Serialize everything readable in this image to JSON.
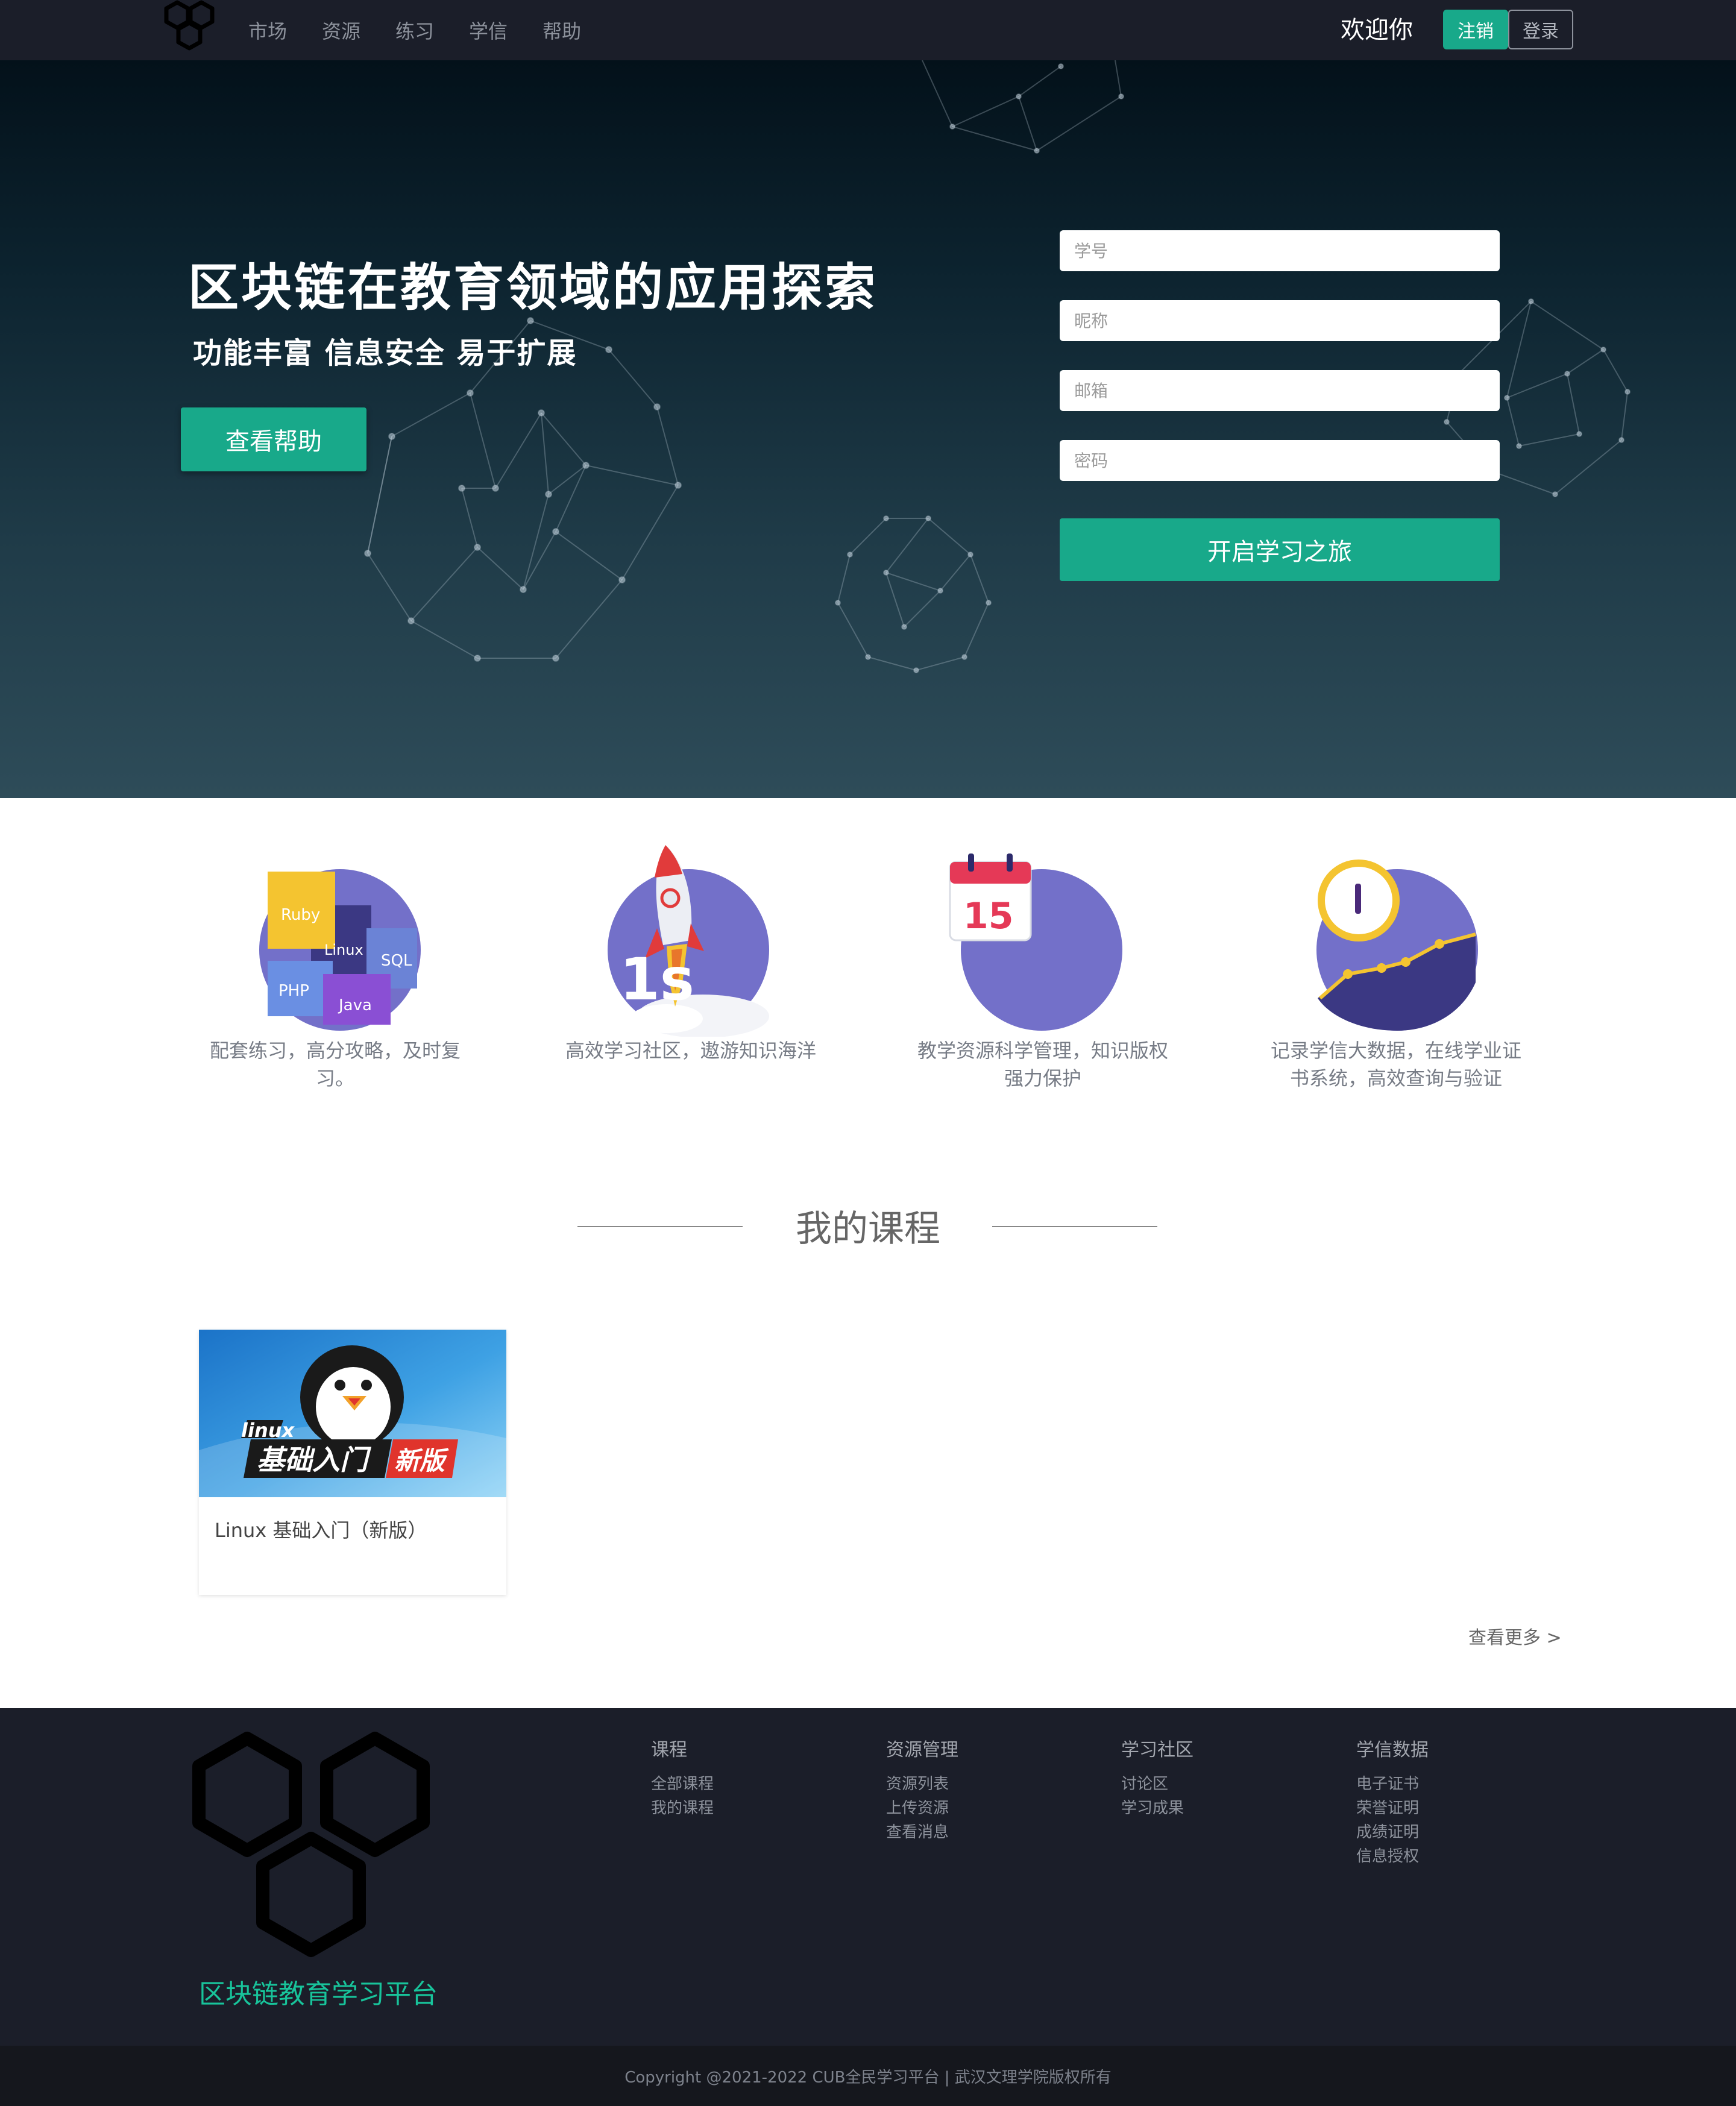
{
  "nav": {
    "links": [
      "市场",
      "资源",
      "练习",
      "学信",
      "帮助"
    ],
    "welcome": "欢迎你",
    "logout": "注销",
    "login": "登录"
  },
  "hero": {
    "title": "区块链在教育领域的应用探索",
    "subtitle": "功能丰富 信息安全 易于扩展",
    "help_button": "查看帮助"
  },
  "register": {
    "student_id_placeholder": "学号",
    "nickname_placeholder": "昵称",
    "email_placeholder": "邮箱",
    "password_placeholder": "密码",
    "submit": "开启学习之旅"
  },
  "features": [
    {
      "icon": "languages-icon",
      "text": "配套练习，高分攻略，及时复习。",
      "labels": [
        "Ruby",
        "Linux",
        "SQL",
        "PHP",
        "Java"
      ]
    },
    {
      "icon": "rocket-icon",
      "text": "高效学习社区，遨游知识海洋",
      "badge": "1s"
    },
    {
      "icon": "calendar-icon",
      "text": "教学资源科学管理，知识版权强力保护",
      "day": "15"
    },
    {
      "icon": "growth-chart-icon",
      "text": "记录学信大数据，在线学业证书系统，高效查询与验证"
    }
  ],
  "courses": {
    "section_title": "我的课程",
    "items": [
      {
        "title": "Linux 基础入门（新版）",
        "thumb_word": "linux",
        "thumb_main": "基础入门",
        "thumb_tag": "新版"
      }
    ],
    "more": "查看更多 >"
  },
  "footer": {
    "brand": "区块链教育学习平台",
    "columns": [
      {
        "heading": "课程",
        "items": [
          "全部课程",
          "我的课程"
        ]
      },
      {
        "heading": "资源管理",
        "items": [
          "资源列表",
          "上传资源",
          "查看消息"
        ]
      },
      {
        "heading": "学习社区",
        "items": [
          "讨论区",
          "学习成果"
        ]
      },
      {
        "heading": "学信数据",
        "items": [
          "电子证书",
          "荣誉证明",
          "成绩证明",
          "信息授权"
        ]
      }
    ],
    "copyright": "Copyright @2021-2022 CUB全民学习平台 | 武汉文理学院版权所有"
  },
  "colors": {
    "accent": "#18a98a",
    "nav_bg": "#1b1e29",
    "feature_circle": "#7370c9"
  }
}
